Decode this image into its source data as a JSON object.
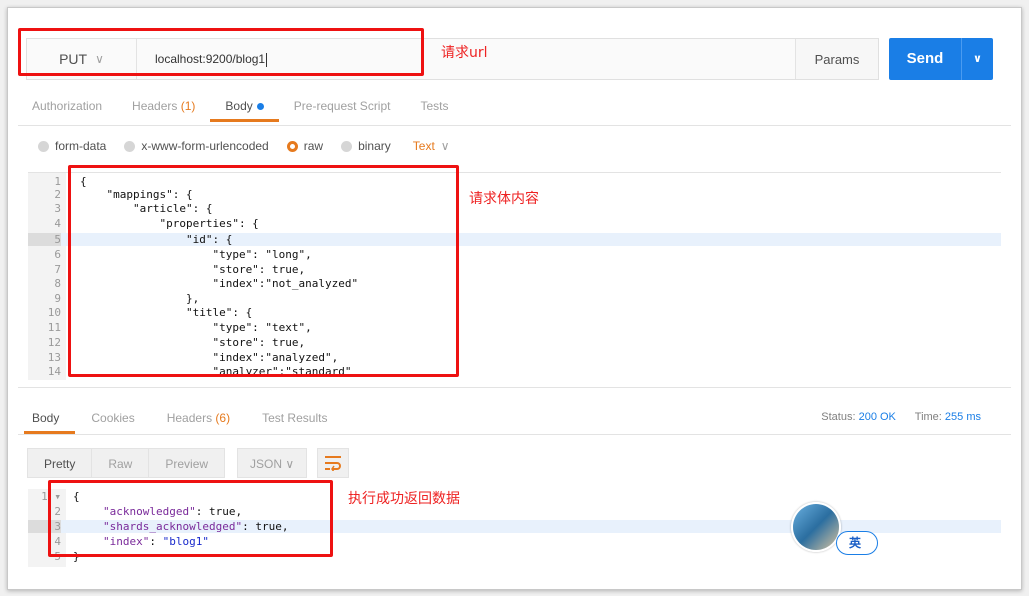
{
  "request": {
    "method": "PUT",
    "url": "localhost:9200/blog1",
    "params_label": "Params",
    "send_label": "Send"
  },
  "annotations": {
    "url": "请求url",
    "body": "请求体内容",
    "response": "执行成功返回数据"
  },
  "request_tabs": [
    {
      "label": "Authorization",
      "count": ""
    },
    {
      "label": "Headers",
      "count": "(1)"
    },
    {
      "label": "Body",
      "count": ""
    },
    {
      "label": "Pre-request Script",
      "count": ""
    },
    {
      "label": "Tests",
      "count": ""
    }
  ],
  "body_modes": {
    "form_data": "form-data",
    "urlencoded": "x-www-form-urlencoded",
    "raw": "raw",
    "binary": "binary",
    "text_type": "Text"
  },
  "request_body": [
    {
      "n": "1",
      "t": "{"
    },
    {
      "n": "2",
      "t": "    \"mappings\": {"
    },
    {
      "n": "3",
      "t": "        \"article\": {"
    },
    {
      "n": "4",
      "t": "            \"properties\": {"
    },
    {
      "n": "5",
      "t": "                \"id\": {"
    },
    {
      "n": "6",
      "t": "                    \"type\": \"long\","
    },
    {
      "n": "7",
      "t": "                    \"store\": true,"
    },
    {
      "n": "8",
      "t": "                    \"index\":\"not_analyzed\""
    },
    {
      "n": "9",
      "t": "                },"
    },
    {
      "n": "10",
      "t": "                \"title\": {"
    },
    {
      "n": "11",
      "t": "                    \"type\": \"text\","
    },
    {
      "n": "12",
      "t": "                    \"store\": true,"
    },
    {
      "n": "13",
      "t": "                    \"index\":\"analyzed\","
    },
    {
      "n": "14",
      "t": "                    \"analyzer\":\"standard\""
    }
  ],
  "response_tabs": [
    {
      "label": "Body",
      "count": ""
    },
    {
      "label": "Cookies",
      "count": ""
    },
    {
      "label": "Headers",
      "count": "(6)"
    },
    {
      "label": "Test Results",
      "count": ""
    }
  ],
  "status": {
    "status_label": "Status:",
    "status_value": "200 OK",
    "time_label": "Time:",
    "time_value": "255 ms"
  },
  "view": {
    "pretty": "Pretty",
    "raw": "Raw",
    "preview": "Preview",
    "format": "JSON"
  },
  "response_body": {
    "l1": "{",
    "k2": "\"acknowledged\"",
    "v2": ": true,",
    "k3": "\"shards_acknowledged\"",
    "v3": ": true,",
    "k4": "\"index\"",
    "s4": "\"blog1\"",
    "l5": "}"
  },
  "ime_label": "英",
  "colors": {
    "accent": "#e67a1e",
    "send": "#1a7ee6",
    "annotation": "#ee1111"
  }
}
